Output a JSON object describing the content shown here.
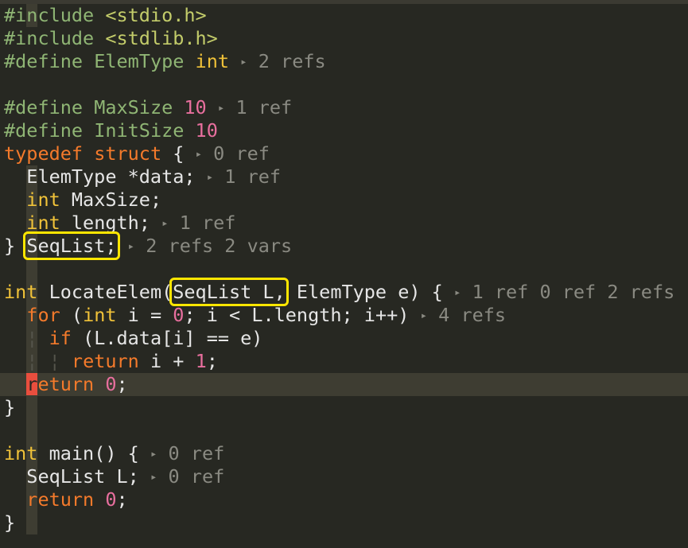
{
  "code": {
    "l1": {
      "pp": "#include",
      "inc": "<stdio.h>"
    },
    "l2": {
      "pp": "#include",
      "inc": "<stdlib.h>"
    },
    "l3": {
      "pp": "#define",
      "name": "ElemType",
      "type": "int",
      "hint": "2 refs"
    },
    "l5": {
      "pp": "#define",
      "name": "MaxSize",
      "num": "10",
      "hint": "1 ref"
    },
    "l6": {
      "pp": "#define",
      "name": "InitSize",
      "num": "10"
    },
    "l7": {
      "kw1": "typedef",
      "kw2": "struct",
      "brace": "{",
      "hint": "0 ref"
    },
    "l8": {
      "text": "ElemType *data;",
      "hint": "1 ref"
    },
    "l9": {
      "type": "int",
      "rest": "MaxSize;"
    },
    "l10": {
      "type": "int",
      "rest": "length;",
      "hint": "1 ref"
    },
    "l11": {
      "brace": "}",
      "name": "SeqList;",
      "hint": "2 refs 2 vars"
    },
    "l13": {
      "type": "int",
      "fname": "LocateElem(",
      "param1": "SeqList L,",
      "param2": "ElemType e) {",
      "hint": "1 ref 0 ref 2 refs"
    },
    "l14": {
      "kw": "for",
      "p1": "(",
      "type": "int",
      "p2": "i =",
      "num": "0",
      "p3": "; i < L.length; i++)",
      "hint": "4 refs"
    },
    "l15": {
      "kw": "if",
      "rest": "(L.data[i] == e)"
    },
    "l16": {
      "kw": "return",
      "rest": "i +",
      "num": "1",
      ";": ";"
    },
    "l17": {
      "cursor": "r",
      "kw": "eturn",
      "num": "0",
      "end": ";"
    },
    "l18": {
      "brace": "}"
    },
    "l20": {
      "type": "int",
      "rest": "main() {",
      "hint": "0 ref"
    },
    "l21": {
      "text": "SeqList L;",
      "hint": "0 ref"
    },
    "l22": {
      "kw": "return",
      "num": "0",
      "end": ";"
    },
    "l23": {
      "brace": "}"
    }
  },
  "icons": {
    "hint_marker": "triangle-right-icon",
    "indent_guide": "indent-guide-icon"
  },
  "colors": {
    "background": "#272822",
    "highlight_box": "#ffe600",
    "cursor": "#e94e3e",
    "preprocessor": "#8fb574",
    "keyword": "#f47a2b",
    "type": "#f0c239",
    "number": "#e86f9e"
  }
}
